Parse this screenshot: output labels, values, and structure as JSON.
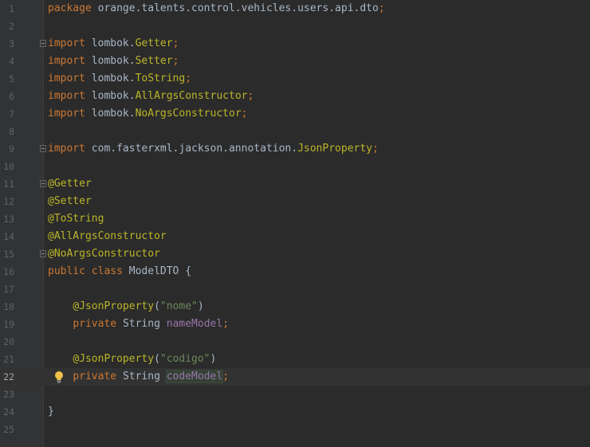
{
  "editor": {
    "current_line": 22,
    "lines": [
      {
        "n": "1",
        "fold": false,
        "tokens": [
          {
            "t": "package ",
            "c": "kw"
          },
          {
            "t": "orange.talents.control.vehicles.users.api.dto",
            "c": "pl"
          },
          {
            "t": ";",
            "c": "kw"
          }
        ]
      },
      {
        "n": "2",
        "fold": false,
        "tokens": []
      },
      {
        "n": "3",
        "fold": true,
        "tokens": [
          {
            "t": "import ",
            "c": "kw"
          },
          {
            "t": "lombok.",
            "c": "pl"
          },
          {
            "t": "Getter",
            "c": "ann"
          },
          {
            "t": ";",
            "c": "kw"
          }
        ]
      },
      {
        "n": "4",
        "fold": false,
        "tokens": [
          {
            "t": "import ",
            "c": "kw"
          },
          {
            "t": "lombok.",
            "c": "pl"
          },
          {
            "t": "Setter",
            "c": "ann"
          },
          {
            "t": ";",
            "c": "kw"
          }
        ]
      },
      {
        "n": "5",
        "fold": false,
        "tokens": [
          {
            "t": "import ",
            "c": "kw"
          },
          {
            "t": "lombok.",
            "c": "pl"
          },
          {
            "t": "ToString",
            "c": "ann"
          },
          {
            "t": ";",
            "c": "kw"
          }
        ]
      },
      {
        "n": "6",
        "fold": false,
        "tokens": [
          {
            "t": "import ",
            "c": "kw"
          },
          {
            "t": "lombok.",
            "c": "pl"
          },
          {
            "t": "AllArgsConstructor",
            "c": "ann"
          },
          {
            "t": ";",
            "c": "kw"
          }
        ]
      },
      {
        "n": "7",
        "fold": false,
        "tokens": [
          {
            "t": "import ",
            "c": "kw"
          },
          {
            "t": "lombok.",
            "c": "pl"
          },
          {
            "t": "NoArgsConstructor",
            "c": "ann"
          },
          {
            "t": ";",
            "c": "kw"
          }
        ]
      },
      {
        "n": "8",
        "fold": false,
        "tokens": []
      },
      {
        "n": "9",
        "fold": true,
        "tokens": [
          {
            "t": "import ",
            "c": "kw"
          },
          {
            "t": "com.fasterxml.jackson.annotation.",
            "c": "pl"
          },
          {
            "t": "JsonProperty",
            "c": "ann"
          },
          {
            "t": ";",
            "c": "kw"
          }
        ]
      },
      {
        "n": "10",
        "fold": false,
        "tokens": []
      },
      {
        "n": "11",
        "fold": true,
        "tokens": [
          {
            "t": "@Getter",
            "c": "ann"
          }
        ]
      },
      {
        "n": "12",
        "fold": false,
        "tokens": [
          {
            "t": "@Setter",
            "c": "ann"
          }
        ]
      },
      {
        "n": "13",
        "fold": false,
        "tokens": [
          {
            "t": "@ToString",
            "c": "ann"
          }
        ]
      },
      {
        "n": "14",
        "fold": false,
        "tokens": [
          {
            "t": "@AllArgsConstructor",
            "c": "ann"
          }
        ]
      },
      {
        "n": "15",
        "fold": true,
        "tokens": [
          {
            "t": "@NoArgsConstructor",
            "c": "ann"
          }
        ]
      },
      {
        "n": "16",
        "fold": false,
        "tokens": [
          {
            "t": "public ",
            "c": "kw"
          },
          {
            "t": "class ",
            "c": "kw"
          },
          {
            "t": "ModelDTO {",
            "c": "pl"
          }
        ]
      },
      {
        "n": "17",
        "fold": false,
        "tokens": []
      },
      {
        "n": "18",
        "fold": false,
        "tokens": [
          {
            "t": "    ",
            "c": "pl"
          },
          {
            "t": "@JsonProperty",
            "c": "ann"
          },
          {
            "t": "(",
            "c": "pl"
          },
          {
            "t": "\"nome\"",
            "c": "str"
          },
          {
            "t": ")",
            "c": "pl"
          }
        ]
      },
      {
        "n": "19",
        "fold": false,
        "tokens": [
          {
            "t": "    ",
            "c": "pl"
          },
          {
            "t": "private ",
            "c": "kw"
          },
          {
            "t": "String ",
            "c": "pl"
          },
          {
            "t": "nameModel",
            "c": "fld"
          },
          {
            "t": ";",
            "c": "kw"
          }
        ]
      },
      {
        "n": "20",
        "fold": false,
        "tokens": []
      },
      {
        "n": "21",
        "fold": false,
        "tokens": [
          {
            "t": "    ",
            "c": "pl"
          },
          {
            "t": "@JsonProperty",
            "c": "ann"
          },
          {
            "t": "(",
            "c": "pl"
          },
          {
            "t": "\"codigo\"",
            "c": "str"
          },
          {
            "t": ")",
            "c": "pl"
          }
        ]
      },
      {
        "n": "22",
        "fold": false,
        "bulb": true,
        "tokens": [
          {
            "t": "    ",
            "c": "pl"
          },
          {
            "t": "private ",
            "c": "kw"
          },
          {
            "t": "String ",
            "c": "pl"
          },
          {
            "t": "codeModel",
            "c": "fld hl"
          },
          {
            "t": ";",
            "c": "kw"
          }
        ]
      },
      {
        "n": "23",
        "fold": false,
        "tokens": []
      },
      {
        "n": "24",
        "fold": false,
        "tokens": [
          {
            "t": "}",
            "c": "pl"
          }
        ]
      },
      {
        "n": "25",
        "fold": false,
        "tokens": []
      }
    ]
  },
  "icons": {
    "fold": "fold-marker-icon",
    "bulb": "lightbulb-icon"
  },
  "colors": {
    "background": "#2b2b2b",
    "keyword": "#cc7832",
    "annotation": "#bbb529",
    "string": "#6a8759",
    "field": "#9876aa",
    "text": "#a9b7c6"
  }
}
